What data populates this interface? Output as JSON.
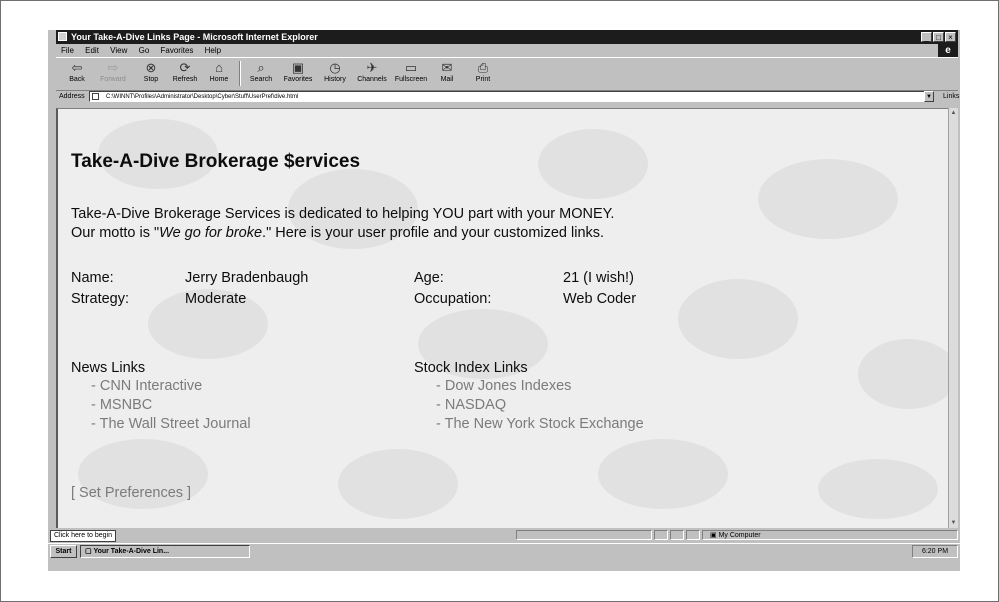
{
  "window": {
    "title": "Your Take-A-Dive Links Page - Microsoft Internet Explorer",
    "controls": [
      "_",
      "□",
      "×"
    ]
  },
  "menu": [
    "File",
    "Edit",
    "View",
    "Go",
    "Favorites",
    "Help"
  ],
  "toolbar": [
    {
      "label": "Back",
      "icon": "back-arrow-icon",
      "glyph": "⇦",
      "enabled": true
    },
    {
      "label": "Forward",
      "icon": "forward-arrow-icon",
      "glyph": "⇨",
      "enabled": false
    },
    {
      "label": "Stop",
      "icon": "stop-icon",
      "glyph": "⊗",
      "enabled": true
    },
    {
      "label": "Refresh",
      "icon": "refresh-icon",
      "glyph": "⟳",
      "enabled": true
    },
    {
      "label": "Home",
      "icon": "home-icon",
      "glyph": "⌂",
      "enabled": true
    },
    {
      "label": "Search",
      "icon": "search-icon",
      "glyph": "⌕",
      "enabled": true
    },
    {
      "label": "Favorites",
      "icon": "favorites-icon",
      "glyph": "▣",
      "enabled": true
    },
    {
      "label": "History",
      "icon": "history-icon",
      "glyph": "◷",
      "enabled": true
    },
    {
      "label": "Channels",
      "icon": "channels-icon",
      "glyph": "✈",
      "enabled": true
    },
    {
      "label": "Fullscreen",
      "icon": "fullscreen-icon",
      "glyph": "▭",
      "enabled": true
    },
    {
      "label": "Mail",
      "icon": "mail-icon",
      "glyph": "✉",
      "enabled": true
    },
    {
      "label": "Print",
      "icon": "print-icon",
      "glyph": "⎙",
      "enabled": true
    }
  ],
  "address": {
    "label": "Address",
    "value": "C:\\WINNT\\Profiles\\Administrator\\Desktop\\Cyber\\Stuff\\UserPref\\dive.html",
    "links_label": "Links"
  },
  "page": {
    "title": "Take-A-Dive Brokerage $ervices",
    "intro_line1": "Take-A-Dive Brokerage Services is dedicated to helping YOU part with your MONEY.",
    "intro_line2_pre": "Our motto is \"",
    "motto": "We go for broke",
    "intro_line2_post": ".\" Here is your user profile and your customized links.",
    "profile": {
      "name_label": "Name:",
      "name_value": "Jerry Bradenbaugh",
      "age_label": "Age:",
      "age_value": "21 (I wish!)",
      "strategy_label": "Strategy:",
      "strategy_value": "Moderate",
      "occupation_label": "Occupation:",
      "occupation_value": "Web Coder"
    },
    "news": {
      "heading": "News Links",
      "links": [
        "- CNN Interactive",
        "- MSNBC",
        "- The Wall Street Journal"
      ]
    },
    "stocks": {
      "heading": "Stock Index Links",
      "links": [
        "- Dow Jones Indexes",
        "- NASDAQ",
        "- The New York Stock Exchange"
      ]
    },
    "preferences_link": "[ Set Preferences ]"
  },
  "status": {
    "text": "Click here to begin",
    "zone": "My Computer"
  },
  "taskbar": {
    "start": "Start",
    "task": "Your Take-A-Dive Lin...",
    "clock": "6:20 PM"
  },
  "colors": {
    "titlebar": "#1c1c1c",
    "chrome": "#c0c0c0",
    "content_bg": "#eeeeee",
    "link_text": "#7b7b7b"
  }
}
